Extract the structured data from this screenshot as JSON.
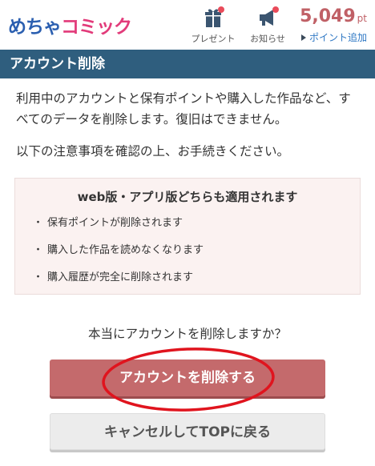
{
  "header": {
    "logo": {
      "part1": "めちゃ",
      "part2": "コミック"
    },
    "present_label": "プレゼント",
    "notice_label": "お知らせ",
    "points_value": "5,049",
    "points_unit": "pt",
    "points_add_label": "ポイント追加"
  },
  "page": {
    "title": "アカウント削除",
    "description": "利用中のアカウントと保有ポイントや購入した作品など、すべてのデータを削除します。復旧はできません。",
    "instruction": "以下の注意事項を確認の上、お手続きください。"
  },
  "notice": {
    "title": "web版・アプリ版どちらも適用されます",
    "bullet": "・",
    "items": [
      "保有ポイントが削除されます",
      "購入した作品を読めなくなります",
      "購入履歴が完全に削除されます"
    ]
  },
  "confirm": {
    "question": "本当にアカウントを削除しますか？",
    "delete_label": "アカウントを削除する",
    "cancel_label": "キャンセルしてTOPに戻る"
  },
  "colors": {
    "title_bar": "#2f5e7e",
    "delete_button": "#c46a6c",
    "points": "#c06066",
    "link": "#2f78c4",
    "annotation_ring": "#e0141e"
  },
  "icons": [
    "gift-icon",
    "megaphone-icon",
    "triangle-right-icon"
  ]
}
